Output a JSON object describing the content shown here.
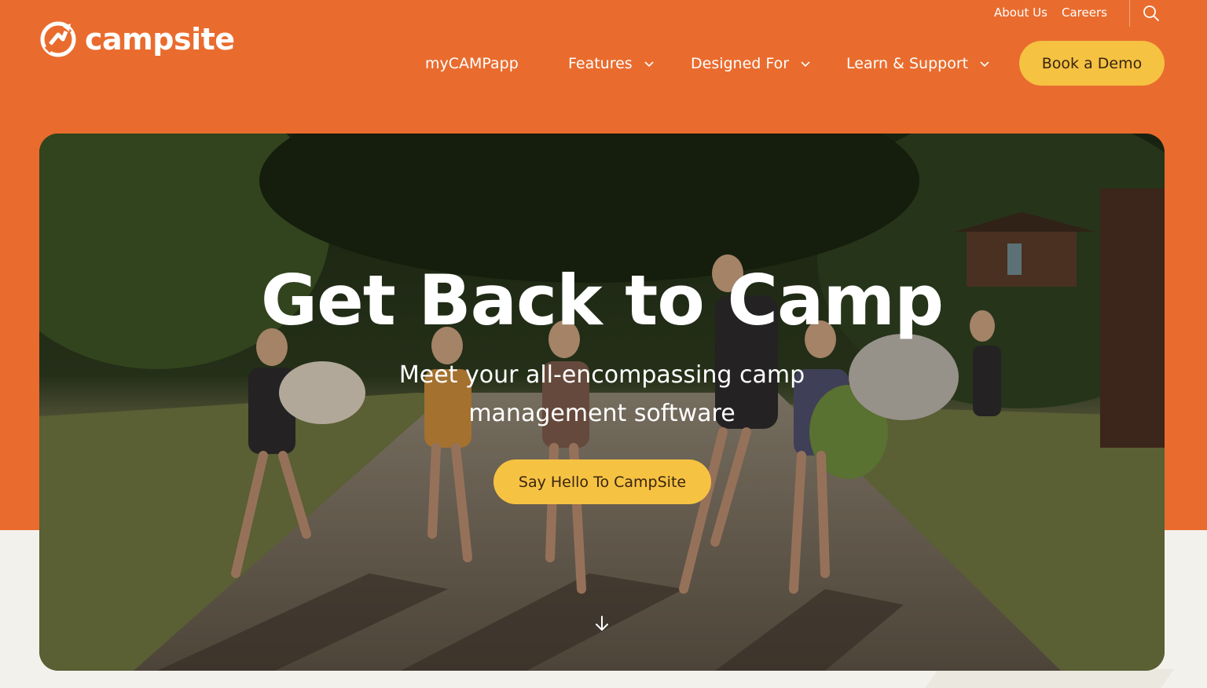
{
  "brand": {
    "name": "campsite",
    "logo_icon": "campsite-logo-icon"
  },
  "utility_nav": [
    {
      "label": "About Us"
    },
    {
      "label": "Careers"
    }
  ],
  "search": {
    "icon": "search-icon"
  },
  "main_nav": [
    {
      "label": "myCAMPapp",
      "has_dropdown": false
    },
    {
      "label": "Features",
      "has_dropdown": true
    },
    {
      "label": "Designed For",
      "has_dropdown": true
    },
    {
      "label": "Learn & Support",
      "has_dropdown": true
    }
  ],
  "cta_header": {
    "label": "Book a Demo"
  },
  "hero": {
    "title": "Get Back to Camp",
    "subtitle": "Meet your all-encompassing camp management software",
    "cta_label": "Say Hello To CampSite",
    "scroll_icon": "arrow-down-icon"
  },
  "colors": {
    "brand_orange": "#e96c2e",
    "button_yellow": "#f5c242",
    "button_text": "#3a2410",
    "page_bg": "#f3f1ec"
  }
}
